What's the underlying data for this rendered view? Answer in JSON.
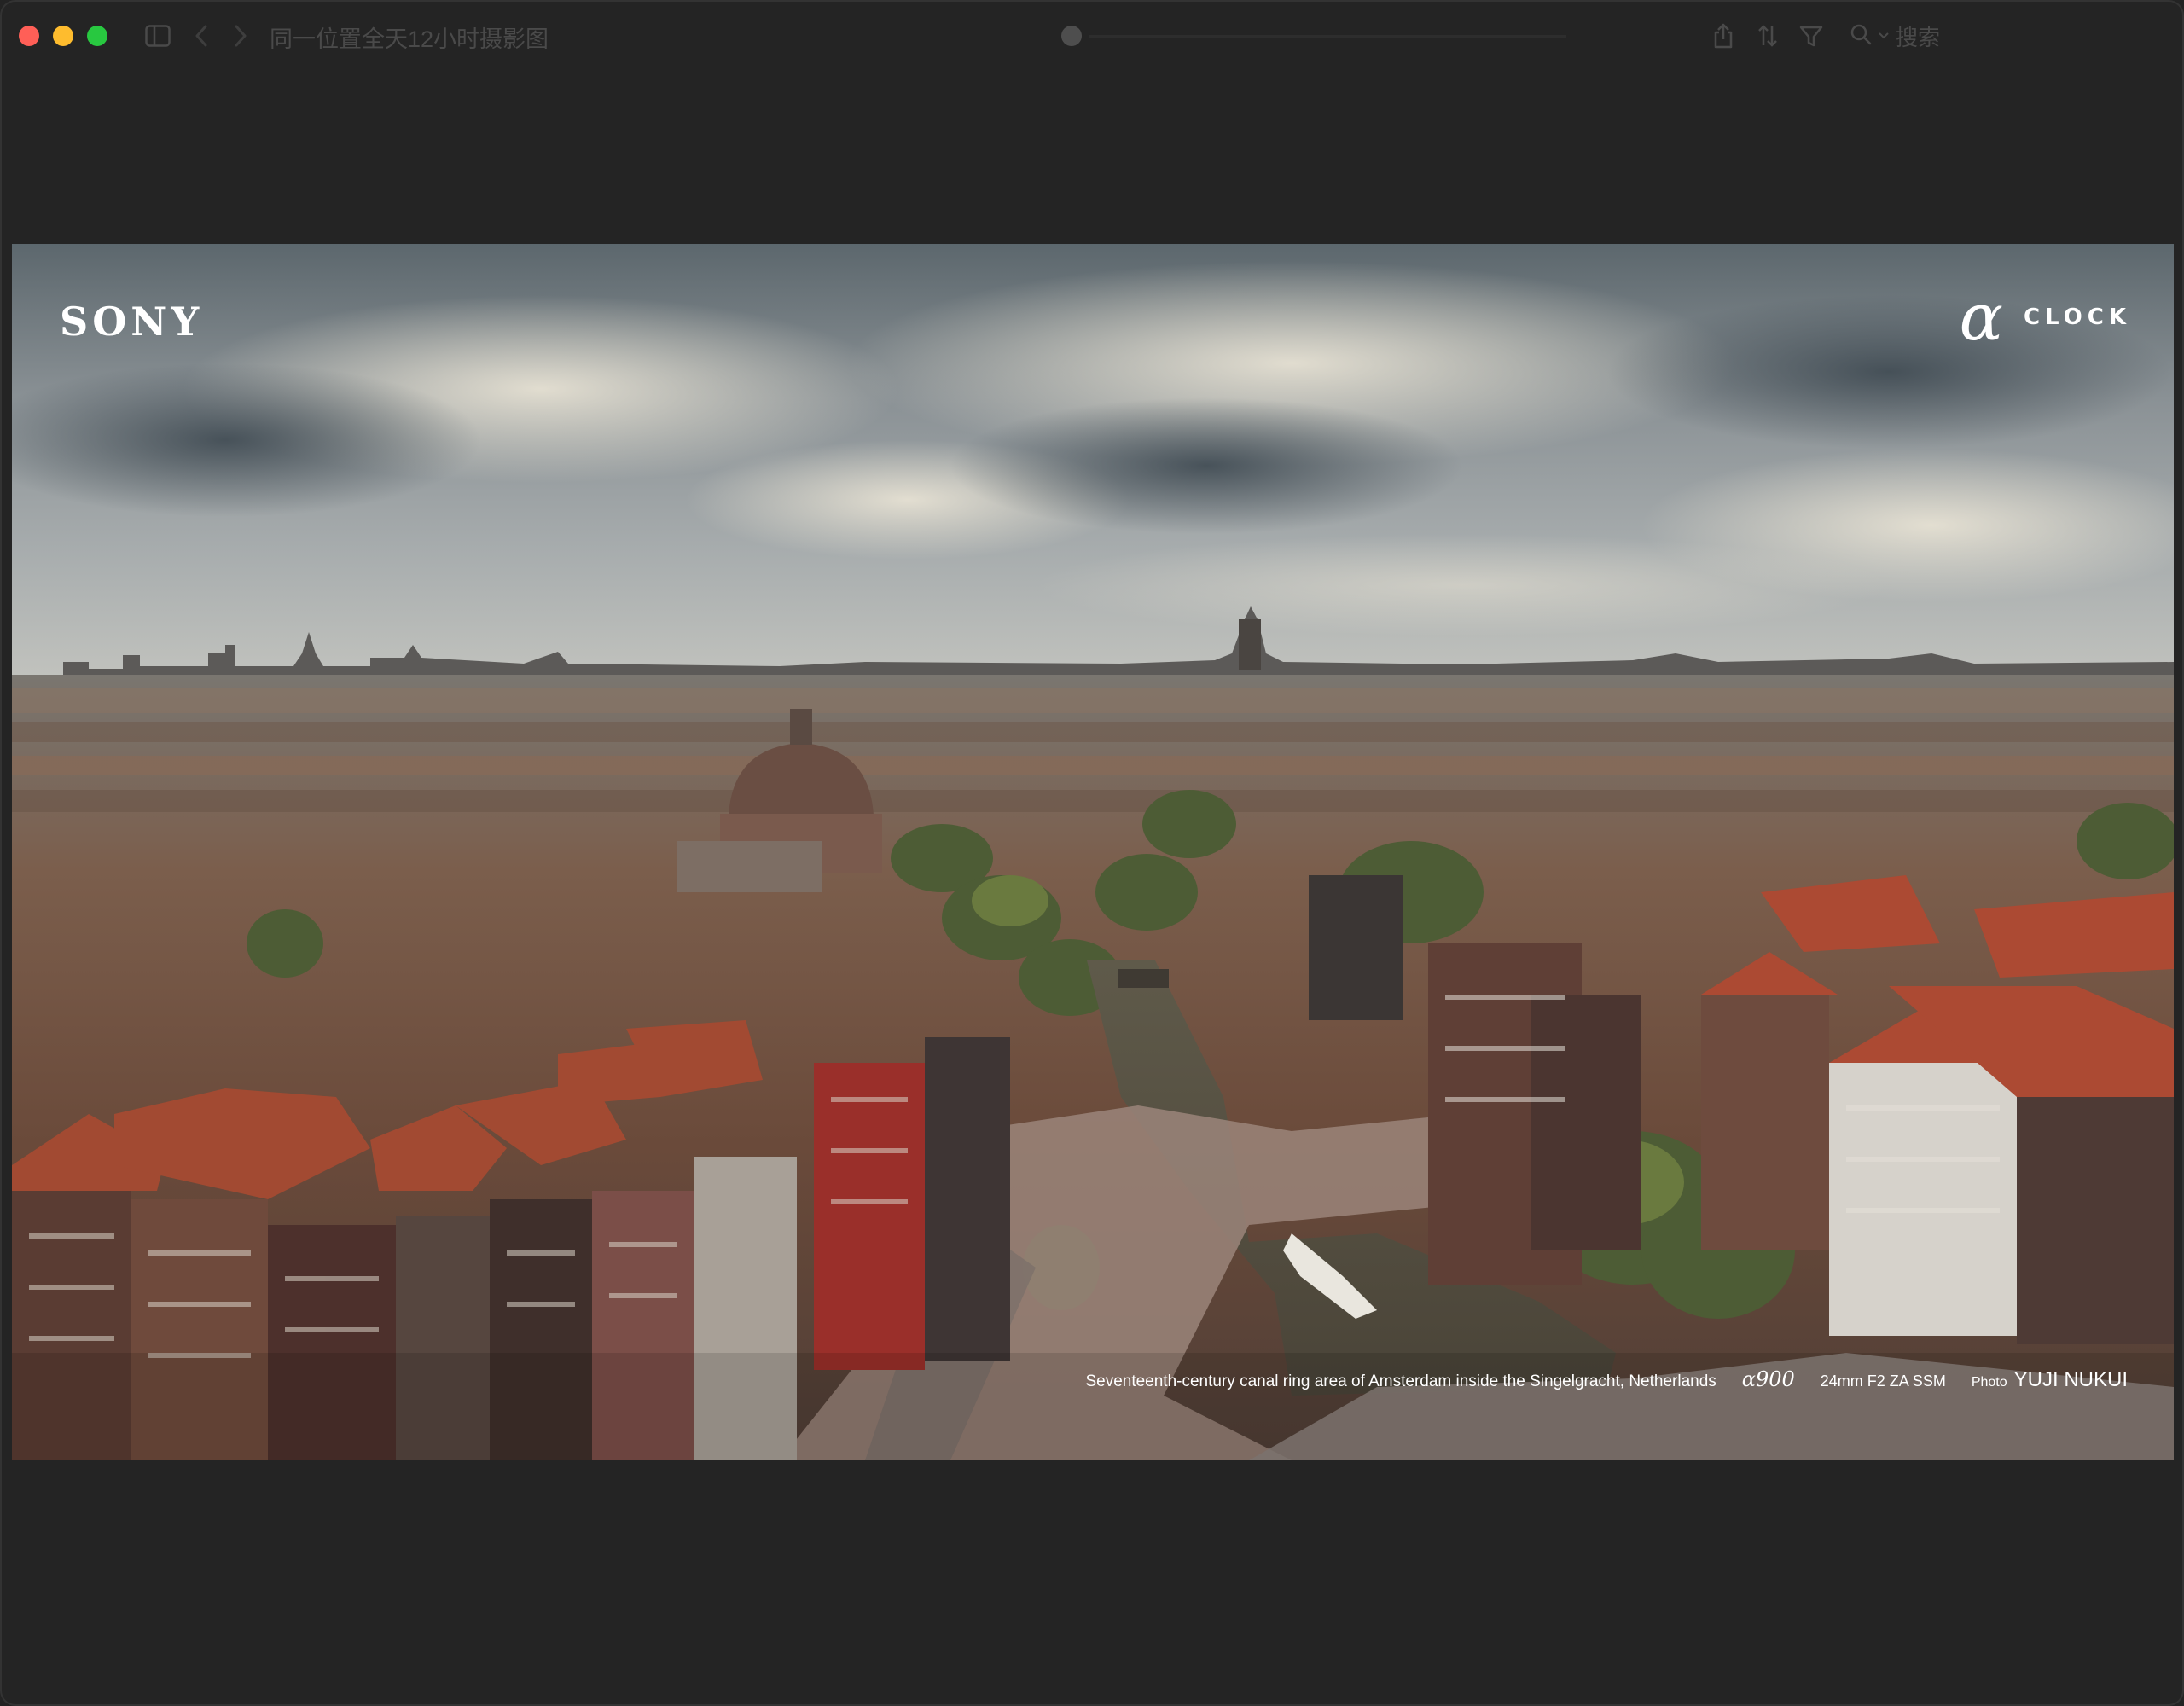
{
  "window": {
    "title": "同一位置全天12小时摄影图",
    "search_label": "搜索",
    "colors": {
      "close": "#ff5f57",
      "minimize": "#febc2e",
      "maximize": "#28c840",
      "background": "#242424"
    }
  },
  "toolbar": {
    "icons": [
      "sidebar-toggle-icon",
      "back-icon",
      "forward-icon",
      "share-icon",
      "sort-icon",
      "filter-icon",
      "search-icon",
      "chevron-down-icon"
    ]
  },
  "photo": {
    "brand": "SONY",
    "alpha_symbol": "α",
    "clock_label": "CLOCK",
    "caption": {
      "description": "Seventeenth-century canal ring area of Amsterdam inside the Singelgracht, Netherlands",
      "camera_model": "α900",
      "lens": "24mm F2 ZA SSM",
      "photo_label": "Photo",
      "photographer": "YUJI NUKUI"
    }
  }
}
